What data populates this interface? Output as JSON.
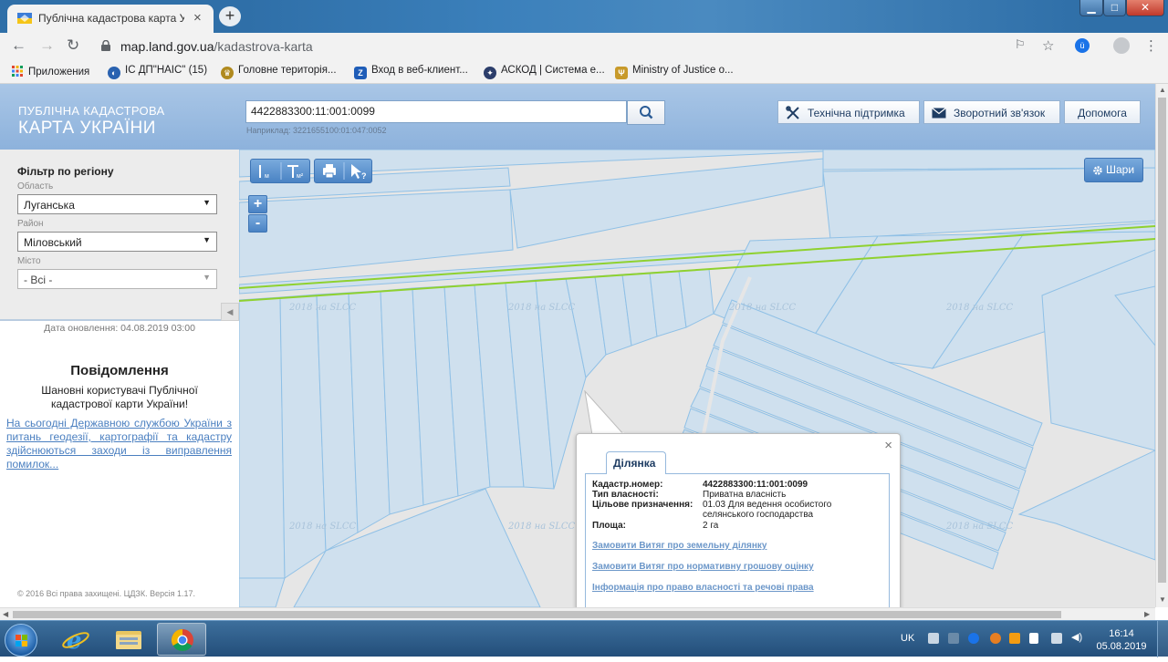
{
  "browser": {
    "tab_title": "Публічна кадастрова карта Укр",
    "tab_close": "×",
    "new_tab": "+",
    "url_host": "map.land.gov.ua",
    "url_path": "/kadastrova-karta",
    "window_controls": {
      "min": "▁",
      "max": "□",
      "close": "✕"
    }
  },
  "bookmarks": [
    {
      "label": "Приложения",
      "icon": "apps-grid-icon",
      "color": "#e0452f"
    },
    {
      "label": "ІС ДП\"НАІС\" (15)",
      "icon": "nais-icon",
      "color": "#2a62b0"
    },
    {
      "label": "Головне територія...",
      "icon": "coat-of-arms-icon",
      "color": "#b08a1e"
    },
    {
      "label": "Вход в веб-клиент...",
      "icon": "zimbra-icon",
      "color": "#1f5db8"
    },
    {
      "label": "АСКОД | Система е...",
      "icon": "askod-icon",
      "color": "#2c3e6b"
    },
    {
      "label": "Ministry of Justice o...",
      "icon": "trident-icon",
      "color": "#c89a2a"
    }
  ],
  "header": {
    "logo_line1": "ПУБЛІЧНА КАДАСТРОВА",
    "logo_line2": "КАРТА УКРАЇНИ",
    "search_value": "4422883300:11:001:0099",
    "search_example": "Наприклад: 3221655100:01:047:0052",
    "support_label": "Технічна підтримка",
    "feedback_label": "Зворотний зв'язок",
    "help_label": "Допомога"
  },
  "filter": {
    "title": "Фільтр по регіону",
    "oblast_label": "Область",
    "oblast_value": "Луганська",
    "raion_label": "Район",
    "raion_value": "Міловський",
    "city_label": "Місто",
    "city_value": "- Всі -"
  },
  "sidebar": {
    "updated": "Дата оновлення: 04.08.2019 03:00",
    "notice_title": "Повідомлення",
    "notice_text": "Шановні користувачі Публічної кадастрової карти України!",
    "notice_link": "На сьогодні Державною службою України з питань геодезії, картографії та кадастру здійснюються заходи із виправлення помилок...",
    "copyright": "© 2016 Всі права захищені. ЦДЗК. Версія 1.17."
  },
  "map": {
    "layers_label": "Шари",
    "zoom_in": "+",
    "zoom_out": "-",
    "watermark": "2018 на SLCC",
    "colors": {
      "parcel_fill": "#cfe0ee",
      "parcel_line": "#8fc0e6",
      "road_line": "#8fd12f",
      "background": "#e6e6e6"
    }
  },
  "popup": {
    "tab": "Ділянка",
    "close": "×",
    "rows": [
      {
        "key": "Кадастр.номер:",
        "value": "4422883300:11:001:0099"
      },
      {
        "key": "Тип власності:",
        "value": "Приватна власність"
      },
      {
        "key": "Цільове призначення:",
        "value": "01.03 Для ведення особистого селянського господарства"
      },
      {
        "key": "Площа:",
        "value": "2 га"
      }
    ],
    "links": [
      "Замовити Витяг про земельну ділянку",
      "Замовити Витяг про нормативну грошову оцінку",
      "Інформація про право власності та речові права"
    ]
  },
  "taskbar": {
    "lang": "UK",
    "time": "16:14",
    "date": "05.08.2019"
  }
}
